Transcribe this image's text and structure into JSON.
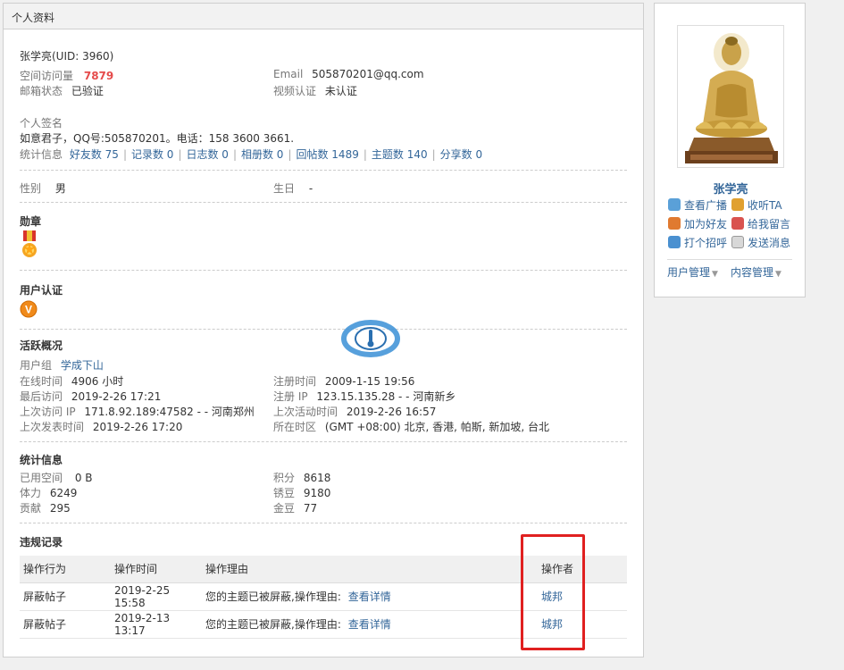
{
  "header": {
    "title": "个人资料"
  },
  "profile": {
    "name_uid": "张学亮(UID: 3960)",
    "visits_label": "空间访问量",
    "visits_value": "7879",
    "email_label": "Email",
    "email_value": "505870201@qq.com",
    "mail_status_label": "邮箱状态",
    "mail_status_value": "已验证",
    "video_label": "视频认证",
    "video_value": "未认证",
    "signature_label": "个人签名",
    "signature_value": "如意君子，QQ号:505870201。电话：158 3600 3661.",
    "stats_label": "统计信息",
    "stats_links": [
      "好友数 75",
      "记录数 0",
      "日志数 0",
      "相册数 0",
      "回帖数 1489",
      "主题数 140",
      "分享数 0"
    ],
    "gender_label": "性别",
    "gender_value": "男",
    "birthday_label": "生日",
    "birthday_value": "-"
  },
  "medals": {
    "title": "勋章"
  },
  "verify": {
    "title": "用户认证",
    "badge": "V"
  },
  "activity": {
    "title": "活跃概况",
    "group_label": "用户组",
    "group_value": "学成下山",
    "online_label": "在线时间",
    "online_value": "4906 小时",
    "register_label": "注册时间",
    "register_value": "2009-1-15 19:56",
    "last_visit_label": "最后访问",
    "last_visit_value": "2019-2-26 17:21",
    "register_ip_label": "注册 IP",
    "register_ip_value": "123.15.135.28 - - 河南新乡",
    "last_ip_label": "上次访问 IP",
    "last_ip_value": "171.8.92.189:47582 - - 河南郑州",
    "last_active_label": "上次活动时间",
    "last_active_value": "2019-2-26 16:57",
    "last_post_label": "上次发表时间",
    "last_post_value": "2019-2-26 17:20",
    "timezone_label": "所在时区",
    "timezone_value": "(GMT +08:00) 北京, 香港, 帕斯, 新加坡, 台北"
  },
  "statistics": {
    "title": "统计信息",
    "space_label": "已用空间",
    "space_value": "0 B",
    "points_label": "积分",
    "points_value": "8618",
    "stamina_label": "体力",
    "stamina_value": "6249",
    "rust_label": "锈豆",
    "rust_value": "9180",
    "contrib_label": "贡献",
    "contrib_value": "295",
    "gold_label": "金豆",
    "gold_value": "77"
  },
  "violations": {
    "title": "违规记录",
    "headers": [
      "操作行为",
      "操作时间",
      "操作理由",
      "操作者"
    ],
    "rows": [
      {
        "action": "屏蔽帖子",
        "time": "2019-2-25 15:58",
        "reason": "您的主题已被屏蔽,操作理由:",
        "link": "查看详情",
        "operator": "城邦"
      },
      {
        "action": "屏蔽帖子",
        "time": "2019-2-13 13:17",
        "reason": "您的主题已被屏蔽,操作理由:",
        "link": "查看详情",
        "operator": "城邦"
      }
    ]
  },
  "sidebar": {
    "name": "张学亮",
    "actions": [
      "查看广播",
      "收听TA",
      "加为好友",
      "给我留言",
      "打个招呼",
      "发送消息"
    ],
    "menus": [
      "用户管理",
      "内容管理"
    ]
  },
  "colors": {
    "link": "#336699",
    "highlight": "#e54b4b",
    "annotation_box": "#e02020"
  }
}
